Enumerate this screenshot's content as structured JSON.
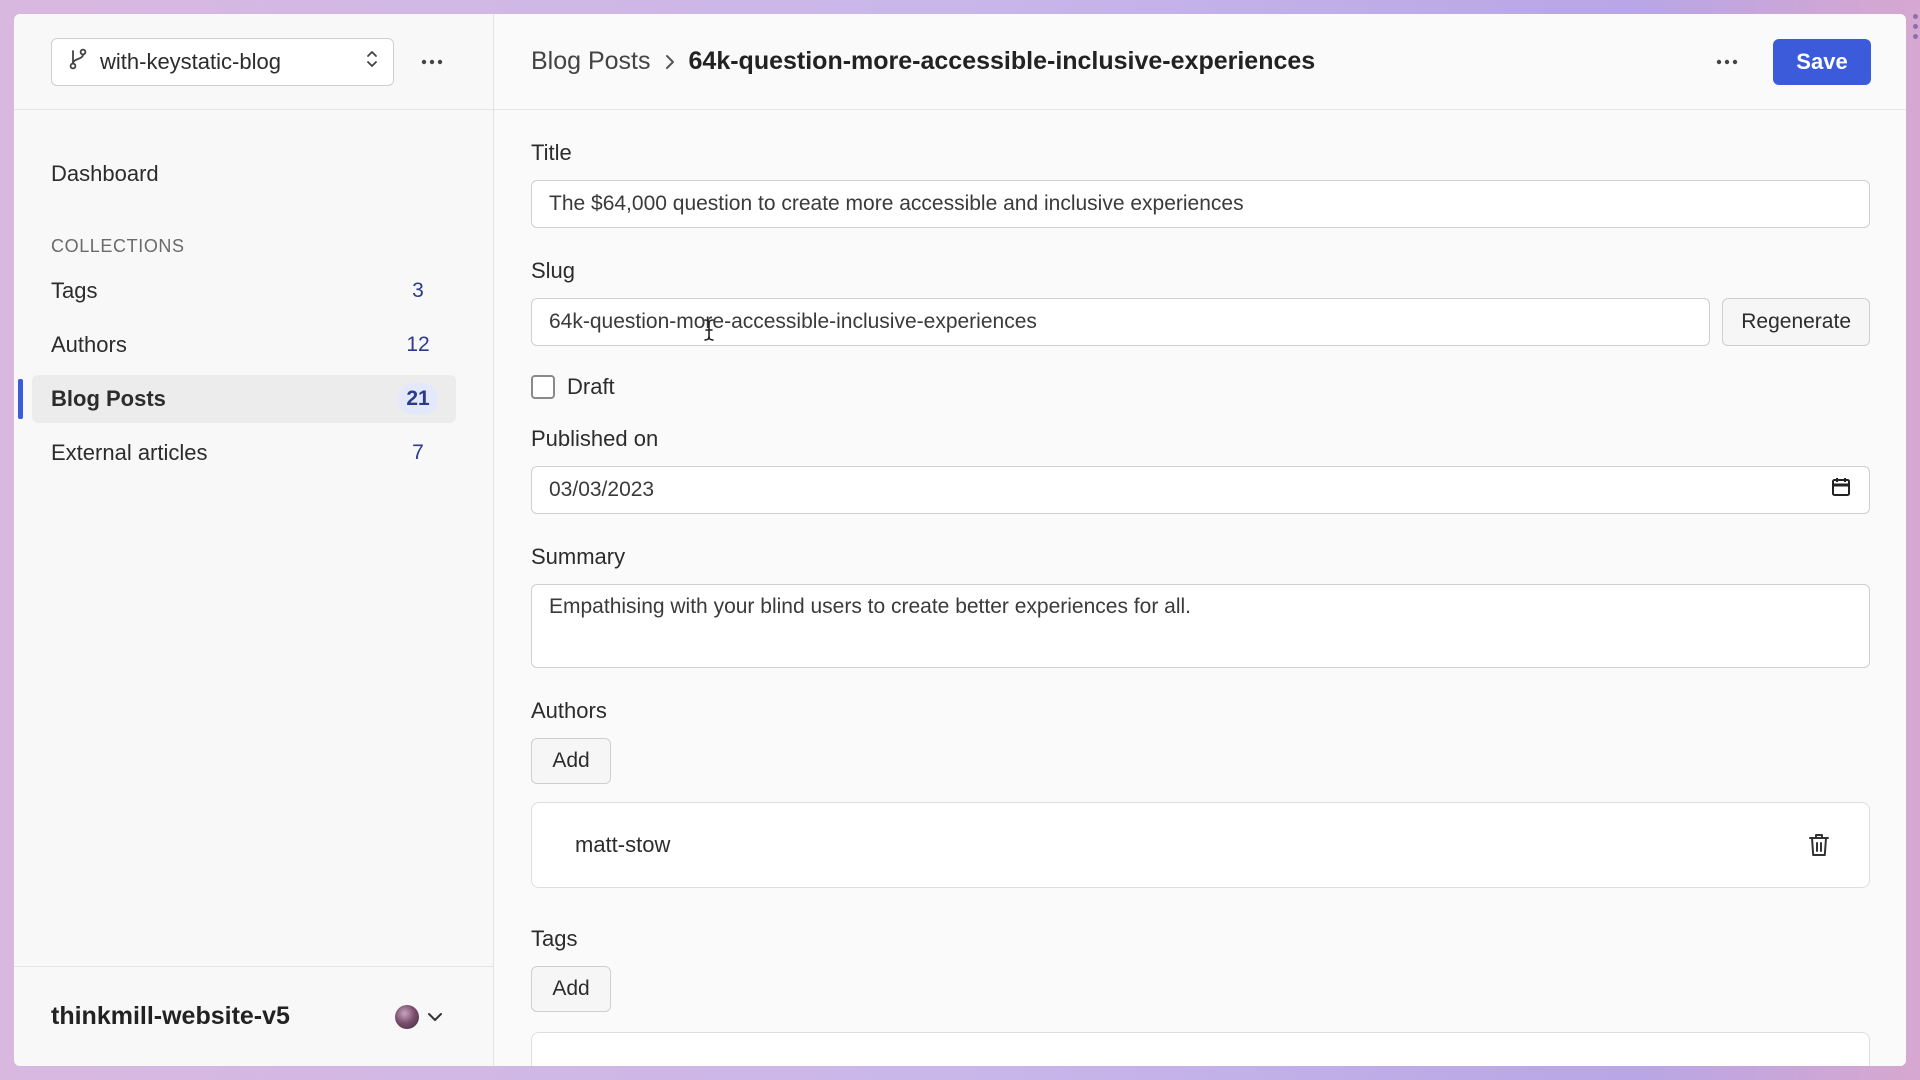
{
  "sidebar": {
    "branch": "with-keystatic-blog",
    "dashboard": "Dashboard",
    "collections_heading": "COLLECTIONS",
    "items": [
      {
        "label": "Tags",
        "count": "3"
      },
      {
        "label": "Authors",
        "count": "12"
      },
      {
        "label": "Blog Posts",
        "count": "21"
      },
      {
        "label": "External articles",
        "count": "7"
      }
    ],
    "project": "thinkmill-website-v5"
  },
  "header": {
    "crumb_parent": "Blog Posts",
    "crumb_current": "64k-question-more-accessible-inclusive-experiences",
    "save_label": "Save"
  },
  "form": {
    "title_label": "Title",
    "title_value": "The $64,000 question to create more accessible and inclusive experiences",
    "slug_label": "Slug",
    "slug_value": "64k-question-more-accessible-inclusive-experiences",
    "regenerate_label": "Regenerate",
    "draft_label": "Draft",
    "draft_checked": false,
    "published_label": "Published on",
    "published_value": "03/03/2023",
    "summary_label": "Summary",
    "summary_value": "Empathising with your blind users to create better experiences for all.",
    "authors_label": "Authors",
    "authors_add": "Add",
    "authors": [
      "matt-stow"
    ],
    "tags_label": "Tags",
    "tags_add": "Add"
  },
  "colors": {
    "accent": "#3b5bdb",
    "active_badge_bg": "#e4e8fb"
  }
}
